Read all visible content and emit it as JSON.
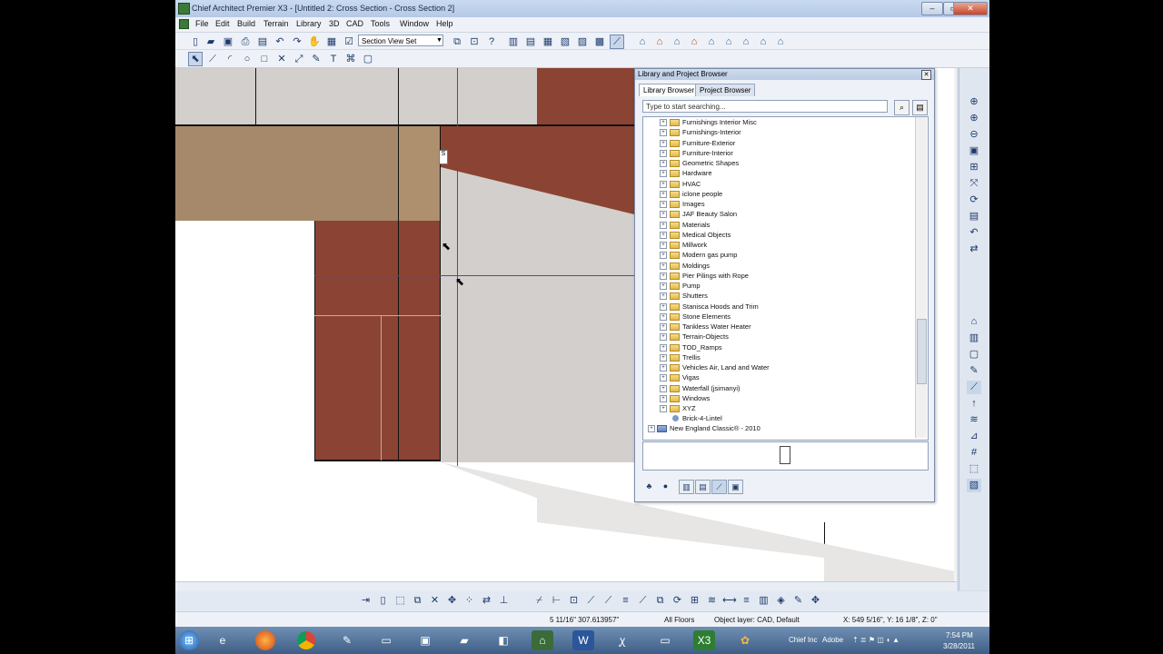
{
  "window": {
    "title": "Chief Architect Premier X3 - [Untitled 2: Cross Section - Cross Section 2]"
  },
  "menu": [
    "File",
    "Edit",
    "Build",
    "Terrain",
    "Library",
    "3D",
    "CAD",
    "Tools",
    "Window",
    "Help"
  ],
  "toolbar": {
    "view_select": "Section View Set"
  },
  "library": {
    "title": "Library and Project Browser",
    "tabs": [
      "Library Browser",
      "Project Browser"
    ],
    "search_placeholder": "Type to start searching...",
    "items": [
      "Furnishings Interior Misc",
      "Furnishings-Interior",
      "Furniture-Exterior",
      "Furniture-Interior",
      "Geometric Shapes",
      "Hardware",
      "HVAC",
      "iclone people",
      "Images",
      "JAF Beauty Salon",
      "Materials",
      "Medical Objects",
      "Millwork",
      "Modern gas pump",
      "Moldings",
      "Pier Pilings with Rope",
      "Pump",
      "Shutters",
      "Stanisca Hoods and Trim",
      "Stone Elements",
      "Tankless Water Heater",
      "Terrain-Objects",
      "TOD_Ramps",
      "Trellis",
      "Vehicles Air, Land and Water",
      "Vigas",
      "Waterfall (jsimanyi)",
      "Windows",
      "XYZ"
    ],
    "leaf_item": "Brick-4-Lintel",
    "root_item": "New England Classic® - 2010"
  },
  "status": {
    "measure": "5 11/16\"  307.613957\"",
    "floors": "All Floors",
    "layer": "Object layer: CAD,  Default",
    "coords": "X: 549 5/16\", Y: 16 1/8\", Z: 0\""
  },
  "taskbar": {
    "app1": "Chief Inc",
    "app2": "Adobe",
    "time": "7:54 PM",
    "date": "3/28/2011"
  },
  "colors": {
    "brick": "#8b4433",
    "tan": "#a6896a",
    "gray": "#cfcbc8",
    "canvas": "#ffffff"
  }
}
